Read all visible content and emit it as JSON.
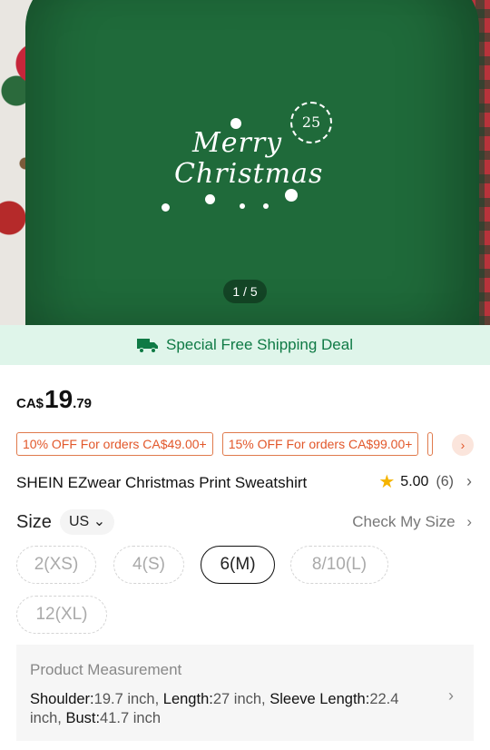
{
  "gallery": {
    "counter": "1 / 5"
  },
  "print": {
    "line1": "Merry",
    "line2": "Christmas",
    "number": "25"
  },
  "shipping": {
    "label": "Special Free Shipping Deal",
    "icon": "truck-icon",
    "color": "#0f7a45"
  },
  "price": {
    "currency": "CA$",
    "integer": "19",
    "decimal": ".79"
  },
  "coupons": [
    {
      "label": "10% OFF For orders CA$49.00+"
    },
    {
      "label": "15% OFF For orders CA$99.00+"
    }
  ],
  "product": {
    "title": "SHEIN EZwear Christmas Print Sweatshirt"
  },
  "rating": {
    "value": "5.00",
    "count": "(6)"
  },
  "size": {
    "label": "Size",
    "unit": "US",
    "check_label": "Check My Size",
    "options": [
      "2(XS)",
      "4(S)",
      "6(M)",
      "8/10(L)",
      "12(XL)"
    ],
    "selected": "6(M)"
  },
  "measurement": {
    "title": "Product Measurement",
    "items": [
      {
        "key": "Shoulder:",
        "value": "19.7 inch, "
      },
      {
        "key": "Length:",
        "value": "27 inch, "
      },
      {
        "key": "Sleeve Length:",
        "value": "22.4 inch, "
      },
      {
        "key": "Bust:",
        "value": "41.7 inch"
      }
    ]
  }
}
